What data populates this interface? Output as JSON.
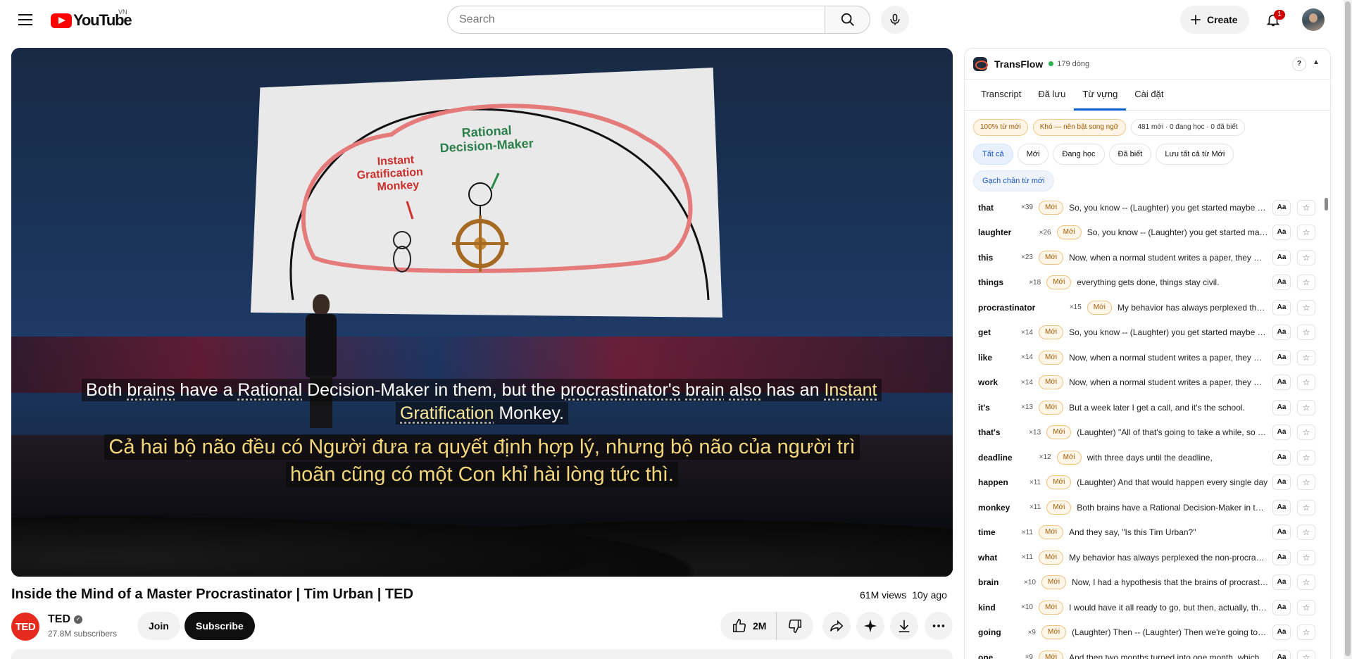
{
  "masthead": {
    "logo_text": "YouTube",
    "country_code": "VN",
    "search_placeholder": "Search",
    "create_label": "Create",
    "notification_count": "1"
  },
  "player": {
    "subtitle_en": {
      "parts": [
        {
          "t": "Both ",
          "hl": false
        },
        {
          "t": "brains",
          "hl": true
        },
        {
          "t": " have a ",
          "hl": false
        },
        {
          "t": "Rational",
          "hl": true
        },
        {
          "t": " Decision-Maker in them, but the ",
          "hl": false
        },
        {
          "t": "procrastinator's",
          "hl": true
        },
        {
          "t": " ",
          "hl": false
        },
        {
          "t": "brain",
          "hl": true
        },
        {
          "t": " ",
          "hl": false
        },
        {
          "t": "also",
          "hl": true
        },
        {
          "t": " has an ",
          "hl": false
        },
        {
          "t": "Instant",
          "hl": "yellow"
        },
        {
          "t": " ",
          "hl": false
        },
        {
          "t": "Gratification",
          "hl": "yellow"
        },
        {
          "t": " Monkey.",
          "hl": false
        }
      ]
    },
    "subtitle_vi": "Cả hai bộ não đều có Người đưa ra quyết định hợp lý, nhưng bộ não của người trì hoãn cũng có một Con khỉ hài lòng tức thì.",
    "slide_labels": {
      "rational": "Rational Decision-Maker",
      "monkey": "Instant Gratification Monkey"
    }
  },
  "video": {
    "title": "Inside the Mind of a Master Procrastinator | Tim Urban | TED",
    "views": "61M views",
    "age": "10y ago",
    "channel": {
      "avatar_text": "TED",
      "name": "TED",
      "subscribers": "27.8M subscribers",
      "join_label": "Join",
      "subscribe_label": "Subscribe"
    },
    "like_count": "2M"
  },
  "panel": {
    "name": "TransFlow",
    "line_count": "179 dòng",
    "help_label": "?",
    "tabs": [
      {
        "label": "Transcript",
        "active": false
      },
      {
        "label": "Đã lưu",
        "active": false
      },
      {
        "label": "Từ vựng",
        "active": true
      },
      {
        "label": "Cài đặt",
        "active": false
      }
    ],
    "info_chips": [
      "100% từ mới",
      "Khó — nên bật song ngữ",
      "481 mới · 0 đang học · 0 đã biết"
    ],
    "filters": [
      "Tất cả",
      "Mới",
      "Đang học",
      "Đã biết",
      "Lưu tất cả từ Mới"
    ],
    "underline_label": "Gạch chân từ mới",
    "aa_label": "Aa",
    "star_icon": "star-icon",
    "vocab": [
      {
        "word": "that",
        "count": "×39",
        "status": "Mới",
        "context": "So, you know -- (Laughter) you get started maybe a little late, but you know what"
      },
      {
        "word": "laughter",
        "count": "×26",
        "status": "Mới",
        "context": "So, you know -- (Laughter) you get started maybe a little late, but you know what"
      },
      {
        "word": "this",
        "count": "×23",
        "status": "Mới",
        "context": "Now, when a normal student writes a paper, they might spread the work out a little"
      },
      {
        "word": "things",
        "count": "×18",
        "status": "Mới",
        "context": "everything gets done, things stay civil."
      },
      {
        "word": "procrastinator",
        "count": "×15",
        "status": "Mới",
        "context": "My behavior has always perplexed the non-procrastinators around me"
      },
      {
        "word": "get",
        "count": "×14",
        "status": "Mới",
        "context": "So, you know -- (Laughter) you get started maybe a little late, but you know what"
      },
      {
        "word": "like",
        "count": "×14",
        "status": "Mới",
        "context": "Now, when a normal student writes a paper, they might spread the work out a little"
      },
      {
        "word": "work",
        "count": "×14",
        "status": "Mới",
        "context": "Now, when a normal student writes a paper, they might spread the work out a little"
      },
      {
        "word": "it's",
        "count": "×13",
        "status": "Mới",
        "context": "But a week later I get a call, and it's the school."
      },
      {
        "word": "that's",
        "count": "×13",
        "status": "Mới",
        "context": "(Laughter) \"All of that's going to take a while, so I'm just going to"
      },
      {
        "word": "deadline",
        "count": "×12",
        "status": "Mới",
        "context": "with three days until the deadline,"
      },
      {
        "word": "happen",
        "count": "×11",
        "status": "Mới",
        "context": "(Laughter) And that would happen every single day"
      },
      {
        "word": "monkey",
        "count": "×11",
        "status": "Mới",
        "context": "Both brains have a Rational Decision-Maker in them, but the procrastinator's brain"
      },
      {
        "word": "time",
        "count": "×11",
        "status": "Mới",
        "context": "And they say, \"Is this Tim Urban?\""
      },
      {
        "word": "what",
        "count": "×11",
        "status": "Mới",
        "context": "My behavior has always perplexed the non-procrastinators around me"
      },
      {
        "word": "brain",
        "count": "×10",
        "status": "Mới",
        "context": "Now, I had a hypothesis that the brains of procrastinators were actually different"
      },
      {
        "word": "kind",
        "count": "×10",
        "status": "Mới",
        "context": "I would have it all ready to go, but then, actually, the paper would come due"
      },
      {
        "word": "going",
        "count": "×9",
        "status": "Mới",
        "context": "(Laughter) Then -- (Laughter) Then we're going to pass by the shelf"
      },
      {
        "word": "one",
        "count": "×9",
        "status": "Mới",
        "context": "And then two months turned into one month, which turned into two weeks"
      }
    ]
  }
}
